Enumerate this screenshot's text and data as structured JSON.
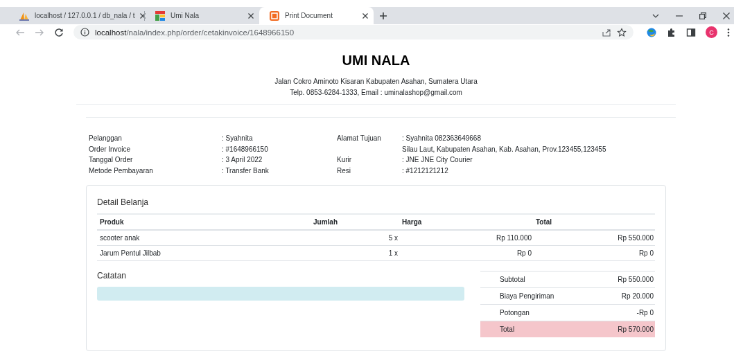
{
  "browser": {
    "tabs": [
      {
        "title": "localhost / 127.0.0.1 / db_nala / t",
        "selected": false
      },
      {
        "title": "Umi Nala",
        "selected": false
      },
      {
        "title": "Print Document",
        "selected": true
      }
    ],
    "url_host": "localhost",
    "url_path": "/nala/index.php/order/cetakinvoice/1648966150",
    "profile_initial": "C"
  },
  "invoice": {
    "shop_name": "UMI NALA",
    "address": "Jalan Cokro Aminoto Kisaran Kabupaten Asahan, Sumatera Utara",
    "contact": "Telp. 0853-6284-1333, Email : uminalashop@gmail.com",
    "info_left": [
      {
        "label": "Pelanggan",
        "value": ": Syahnita"
      },
      {
        "label": "Order Invoice",
        "value": ": #1648966150"
      },
      {
        "label": "Tanggal Order",
        "value": ": 3 April 2022"
      },
      {
        "label": "Metode Pembayaran",
        "value": ": Transfer Bank"
      }
    ],
    "info_right": [
      {
        "label": "Alamat Tujuan",
        "value": ": Syahnita 082363649668"
      },
      {
        "value": "Silau Laut, Kabupaten Asahan, Kab. Asahan, Prov.123455,123455"
      },
      {
        "label": "Kurir",
        "value": ": JNE JNE City Courier"
      },
      {
        "label": "Resi",
        "value": ": #1212121212"
      }
    ],
    "detail_title": "Detail Belanja",
    "columns": [
      "Produk",
      "Jumlah",
      "Harga",
      "Total"
    ],
    "rows": [
      [
        "scooter anak",
        "5 x",
        "Rp 110.000",
        "Rp 550.000"
      ],
      [
        "Jarum Pentul Jilbab",
        "1 x",
        "Rp 0",
        "Rp 0"
      ]
    ],
    "notes_title": "Catatan",
    "summary": [
      {
        "label": "Subtotal",
        "value": "Rp 550.000",
        "highlighted": false
      },
      {
        "label": "Biaya Pengiriman",
        "value": "Rp 20.000",
        "highlighted": false
      },
      {
        "label": "Potongan",
        "value": "-Rp 0",
        "highlighted": false
      },
      {
        "label": "Total",
        "value": "Rp 570.000",
        "highlighted": true
      }
    ]
  }
}
